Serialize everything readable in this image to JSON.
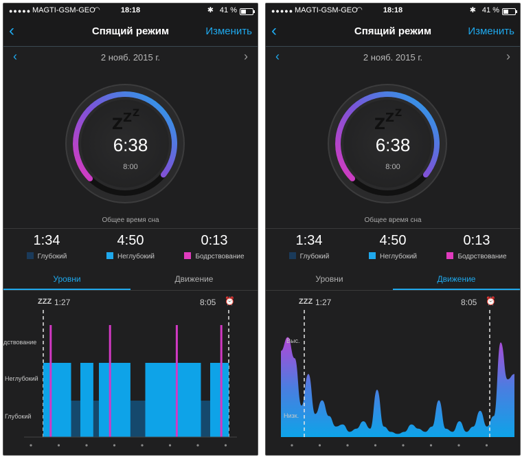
{
  "status": {
    "carrier": "MAGTI-GSM-GEO",
    "time": "18:18",
    "battery": "41 %"
  },
  "nav": {
    "back": "‹",
    "title": "Спящий режим",
    "edit": "Изменить"
  },
  "date": {
    "prev": "‹",
    "label": "2 нояб. 2015 г.",
    "next": "›"
  },
  "summary": {
    "total": "6:38",
    "target": "8:00",
    "caption": "Общее время сна",
    "goal_fraction": 0.83
  },
  "stats": [
    {
      "value": "1:34",
      "label": "Глубокий",
      "color": "#1a3a5a"
    },
    {
      "value": "4:50",
      "label": "Неглубокий",
      "color": "#1fa8ec"
    },
    {
      "value": "0:13",
      "label": "Бодрствование",
      "color": "#e03bbd"
    }
  ],
  "tabs": [
    "Уровни",
    "Движение"
  ],
  "chart_head": {
    "zzz": "ZZZ",
    "start": "1:27",
    "end": "8:05",
    "alarm": "⏰"
  },
  "levels_chart": {
    "ylabels": [
      "дствование",
      "Неглубокий",
      "Глубокий"
    ],
    "colors": {
      "light": "#0ea3e8",
      "deep": "#15496d",
      "awake": "#d239c4"
    }
  },
  "movement_chart": {
    "ylabels": [
      "Выс.",
      "Низк."
    ]
  },
  "chart_data": [
    {
      "type": "area",
      "title": "Уровни",
      "x_start": "1:27",
      "x_end": "8:05",
      "levels": [
        "Глубокий",
        "Неглубокий",
        "дствование"
      ],
      "segments": [
        {
          "from": 0.0,
          "to": 0.15,
          "level": "Неглубокий"
        },
        {
          "from": 0.15,
          "to": 0.2,
          "level": "Глубокий"
        },
        {
          "from": 0.2,
          "to": 0.27,
          "level": "Неглубокий"
        },
        {
          "from": 0.27,
          "to": 0.3,
          "level": "Глубокий"
        },
        {
          "from": 0.3,
          "to": 0.47,
          "level": "Неглубокий"
        },
        {
          "from": 0.47,
          "to": 0.55,
          "level": "Глубокий"
        },
        {
          "from": 0.55,
          "to": 0.85,
          "level": "Неглубокий"
        },
        {
          "from": 0.85,
          "to": 0.9,
          "level": "Глубокий"
        },
        {
          "from": 0.9,
          "to": 1.0,
          "level": "Неглубокий"
        }
      ],
      "awake_marks": [
        0.04,
        0.36,
        0.72,
        0.96
      ]
    },
    {
      "type": "area",
      "title": "Движение",
      "x_start": "1:27",
      "x_end": "8:05",
      "values": [
        0.82,
        0.95,
        0.75,
        0.3,
        0.6,
        0.22,
        0.35,
        0.2,
        0.1,
        0.12,
        0.05,
        0.08,
        0.15,
        0.08,
        0.45,
        0.1,
        0.05,
        0.03,
        0.05,
        0.12,
        0.08,
        0.05,
        0.1,
        0.35,
        0.08,
        0.05,
        0.15,
        0.05,
        0.1,
        0.25,
        0.1,
        0.2,
        0.9,
        0.55,
        0.6
      ]
    }
  ]
}
